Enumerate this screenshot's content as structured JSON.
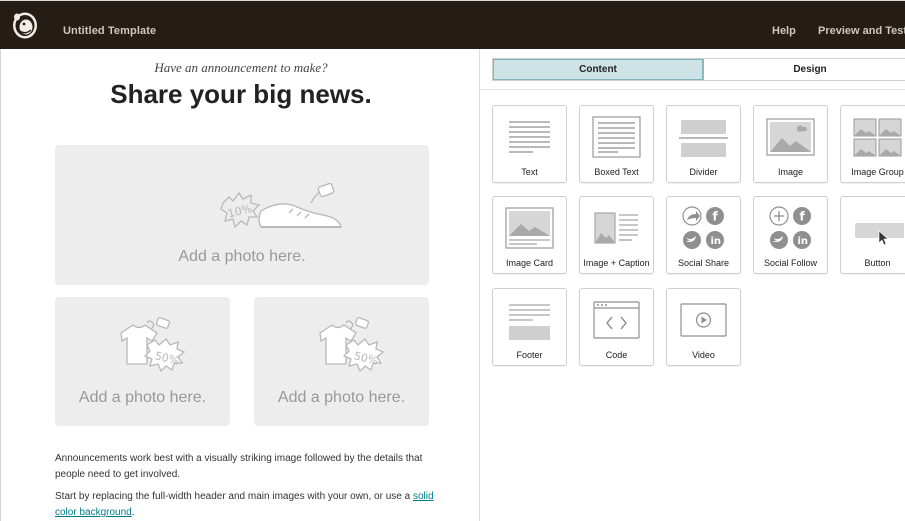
{
  "header": {
    "app_title": "Untitled Template",
    "help_label": "Help",
    "preview_label": "Preview and Test",
    "preview_chevron": "⌄"
  },
  "canvas": {
    "announcement": "Have an announcement to make?",
    "headline": "Share your big news.",
    "photo_main_label": "Add a photo here.",
    "photo_left_label": "Add a photo here.",
    "photo_right_label": "Add a photo here.",
    "paragraph_1": "Announcements work best with a visually striking image followed by the details that people need to get involved.",
    "paragraph_2_prefix": "Start by replacing the full-width header and main images with your own, or use a ",
    "paragraph_2_link": "solid color background",
    "paragraph_2_suffix": "."
  },
  "panel": {
    "tabs": [
      {
        "label": "Content",
        "selected": true
      },
      {
        "label": "Design",
        "selected": false
      }
    ],
    "blocks": [
      {
        "label": "Text",
        "icon": "text-block-icon"
      },
      {
        "label": "Boxed Text",
        "icon": "boxed-text-block-icon"
      },
      {
        "label": "Divider",
        "icon": "divider-block-icon"
      },
      {
        "label": "Image",
        "icon": "image-block-icon"
      },
      {
        "label": "Image Group",
        "icon": "image-group-block-icon"
      },
      {
        "label": "Image Card",
        "icon": "image-card-block-icon"
      },
      {
        "label": "Image + Caption",
        "icon": "image-caption-block-icon"
      },
      {
        "label": "Social Share",
        "icon": "social-share-block-icon"
      },
      {
        "label": "Social Follow",
        "icon": "social-follow-block-icon"
      },
      {
        "label": "Button",
        "icon": "button-block-icon"
      },
      {
        "label": "Footer",
        "icon": "footer-block-icon"
      },
      {
        "label": "Code",
        "icon": "code-block-icon"
      },
      {
        "label": "Video",
        "icon": "video-block-icon"
      }
    ]
  },
  "colors": {
    "topbar_bg": "#241c15",
    "selected_tab_bg": "#cde3e6",
    "link": "#007c89",
    "placeholder_bg": "#ededed"
  }
}
